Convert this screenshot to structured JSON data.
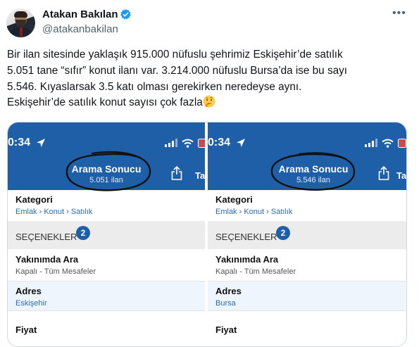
{
  "author": {
    "name": "Atakan Bakılan",
    "handle": "@atakanbakilan"
  },
  "tweet": {
    "lines": [
      "Bir ilan sitesinde yaklaşık 915.000 nüfuslu şehrimiz Eskişehir’de satılık",
      "5.051 tane “sıfır” konut ilanı var. 3.214.000 nüfuslu Bursa’da ise bu sayı",
      "5.546. Kıyaslarsak 3.5 katı olması gerekirken neredeyse aynı.",
      "Eskişehir’de satılık konut sayısı çok fazla"
    ],
    "emoji": "thinking-face"
  },
  "screens": [
    {
      "time": "0:34",
      "title": "Arama Sonucu",
      "count": "5.051 ilan",
      "share_label": "Ta",
      "category_label": "Kategori",
      "category_path": "Emlak › Konut › Satılık",
      "options_label": "SEÇENEKLER",
      "options_count": "2",
      "nearby_label": "Yakınımda Ara",
      "nearby_value": "Kapalı - Tüm Mesafeler",
      "address_label": "Adres",
      "address_value": "Eskişehir",
      "price_label": "Fiyat"
    },
    {
      "time": "0:34",
      "title": "Arama Sonucu",
      "count": "5.546 ilan",
      "share_label": "Ta",
      "category_label": "Kategori",
      "category_path": "Emlak › Konut › Satılık",
      "options_label": "SEÇENEKLER",
      "options_count": "2",
      "nearby_label": "Yakınımda Ara",
      "nearby_value": "Kapalı - Tüm Mesafeler",
      "address_label": "Adres",
      "address_value": "Bursa",
      "price_label": "Fiyat"
    }
  ],
  "colors": {
    "header_blue": "#1e5fa8",
    "link_blue": "#2a6bb8",
    "verified": "#1d9bf0"
  },
  "icons": [
    "verified-badge-icon",
    "more-icon",
    "location-arrow-icon",
    "signal-icon",
    "wifi-icon",
    "battery-icon",
    "share-icon",
    "thinking-face-emoji"
  ]
}
